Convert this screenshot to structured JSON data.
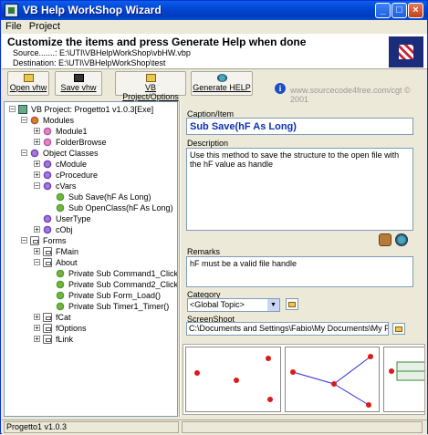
{
  "window": {
    "title": "VB Help WorkShop Wizard"
  },
  "menu": {
    "file": "File",
    "project": "Project"
  },
  "header": {
    "heading": "Customize the items and press Generate Help when done",
    "source": "Source.......: E:\\UTI\\VBHelpWorkShop\\vbHW.vbp",
    "destination": "Destination: E:\\UTI\\VBHelpWorkShop\\test"
  },
  "toolbar": {
    "open": "Open vhw",
    "save": "Save vhw",
    "project_options": "VB Project/Options",
    "generate": "Generate HELP",
    "url": "www.sourcecode4free.com/cgt © 2001"
  },
  "tree": {
    "root": "VB Project: Progetto1 v1.0.3[Exe]",
    "modules": "Modules",
    "module1": "Module1",
    "folderbrowse": "FolderBrowse",
    "object_classes": "Object Classes",
    "cmodule": "cModule",
    "cprocedure": "cProcedure",
    "cvars": "cVars",
    "sub_save": "Sub Save(hF As Long)",
    "sub_openclass": "Sub OpenClass(hF As Long)",
    "usertype": "UserType",
    "cobj": "cObj",
    "forms": "Forms",
    "fmain": "FMain",
    "about": "About",
    "cmd1": "Private Sub Command1_Click()",
    "cmd2": "Private Sub Command2_Click()",
    "formload": "Private Sub Form_Load()",
    "timer": "Private Sub Timer1_Timer()",
    "fcat": "fCat",
    "foptions": "fOptions",
    "flink": "fLink"
  },
  "details": {
    "caption_label": "Caption/Item",
    "caption_value": "Sub Save(hF As Long)",
    "description_label": "Description",
    "description_value": "Use this method to save the structure to the open file with the hF value as handle",
    "remarks_label": "Remarks",
    "remarks_value": "hF must be a valid file handle",
    "category_label": "Category",
    "category_value": "<Global Topic>",
    "screenshot_label": "ScreenShoot",
    "screenshot_path": "C:\\Documents and Settings\\Fabio\\My Documents\\My Pictures\\W"
  },
  "status": {
    "text": "Progetto1 v1.0.3"
  }
}
